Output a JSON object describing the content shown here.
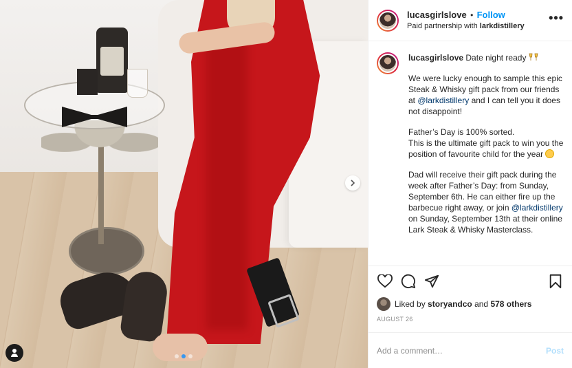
{
  "post": {
    "username": "lucasgirlslove",
    "follow_label": "Follow",
    "separator": "•",
    "partnership_prefix": "Paid partnership with",
    "partner_name": "larkdistillery",
    "more_label": "•••"
  },
  "caption": {
    "username": "lucasgirlslove",
    "headline": "Date night ready",
    "p1_before": "We were lucky enough to sample this epic Steak & Whisky gift pack from our friends at",
    "p1_mention": "@larkdistillery",
    "p1_after": "and I can tell you it does not disappoint!",
    "p2_line1": "Father’s Day is 100% sorted.",
    "p2_line2": "This is the ultimate gift pack to win you the position of favourite child for the year",
    "p3_before": "Dad will receive their gift pack during the week after Father’s Day: from Sunday, September 6th. He can either fire up the barbecue right away, or join",
    "p3_mention": "@larkdistillery",
    "p3_after": "on Sunday, September 13th at their online Lark Steak & Whisky Masterclass."
  },
  "icons": {
    "like": "heart-icon",
    "comment": "comment-icon",
    "share": "paper-plane-icon",
    "save": "bookmark-icon",
    "next": "chevron-right-icon",
    "tags": "user-tag-icon"
  },
  "likes": {
    "prefix": "Liked by",
    "user": "storyandco",
    "middle": "and",
    "others": "578 others"
  },
  "date": "AUGUST 26",
  "comment": {
    "placeholder": "Add a comment…",
    "post_label": "Post"
  },
  "carousel": {
    "count": 3,
    "active_index": 1
  },
  "colors": {
    "link_blue": "#0095f6",
    "mention": "#00376b",
    "post_disabled": "#b2dffc",
    "muted": "#8e8e8e"
  }
}
